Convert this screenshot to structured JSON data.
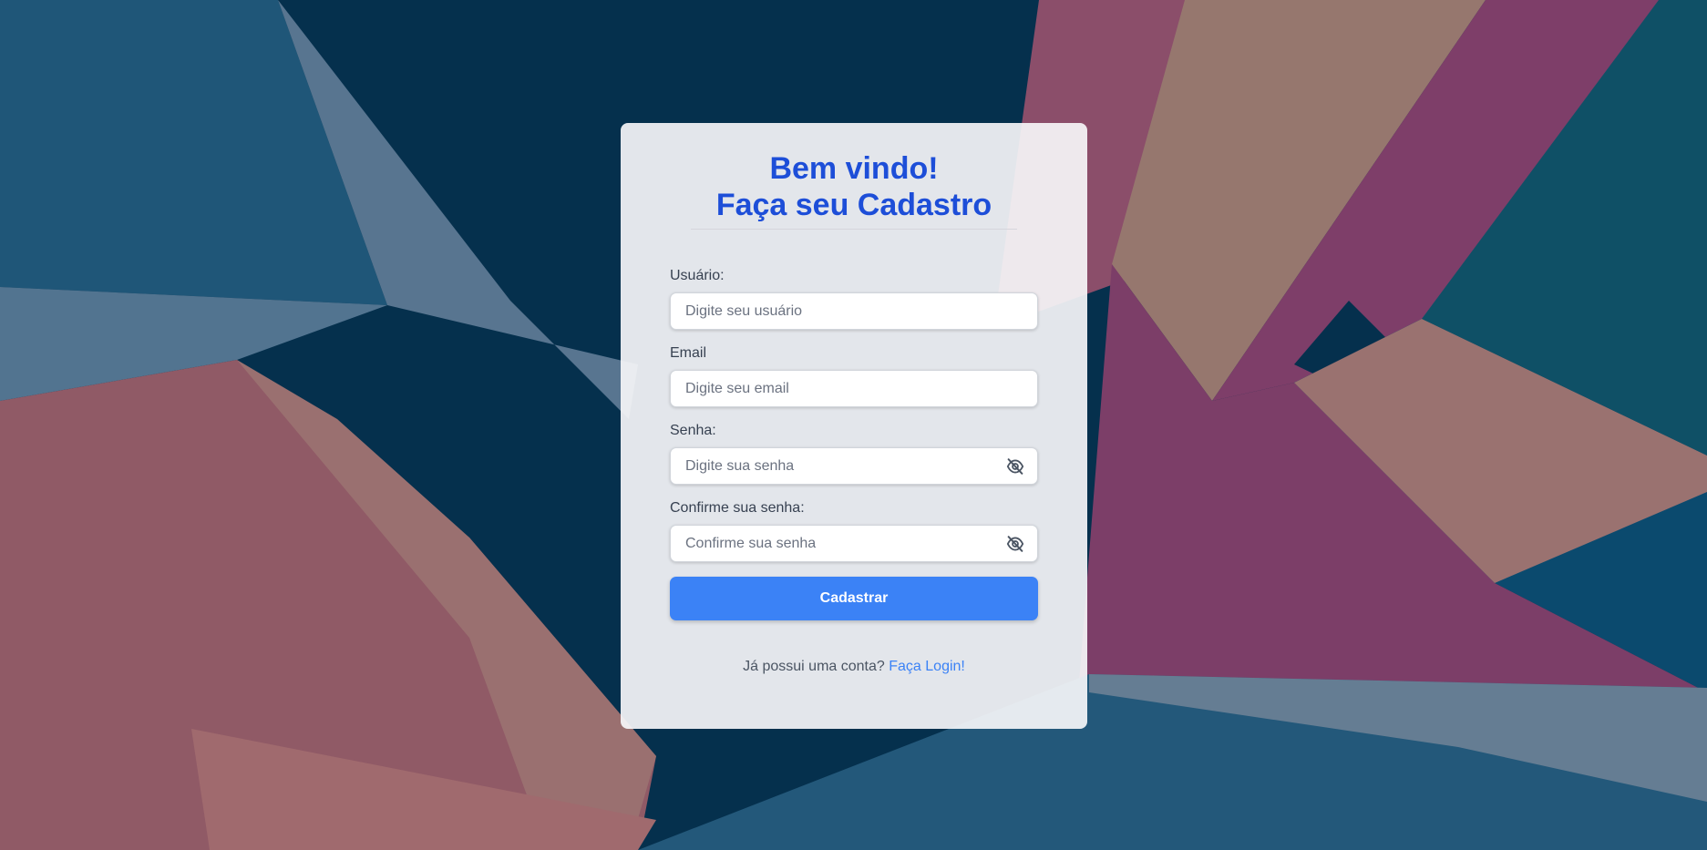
{
  "page": {
    "title_line1": "Bem vindo!",
    "title_line2": "Faça seu Cadastro"
  },
  "form": {
    "username": {
      "label": "Usuário:",
      "placeholder": "Digite seu usuário",
      "value": ""
    },
    "email": {
      "label": "Email",
      "placeholder": "Digite seu email",
      "value": ""
    },
    "password": {
      "label": "Senha:",
      "placeholder": "Digite sua senha",
      "value": ""
    },
    "confirm_password": {
      "label": "Confirme sua senha:",
      "placeholder": "Confirme sua senha",
      "value": ""
    },
    "submit_label": "Cadastrar"
  },
  "footer": {
    "text": "Já possui uma conta?",
    "link_label": "Faça Login!"
  },
  "icons": {
    "password_toggle": "eye-slash-icon"
  },
  "colors": {
    "accent": "#3b82f6",
    "title": "#1d4ed8",
    "background": "#05304d"
  }
}
